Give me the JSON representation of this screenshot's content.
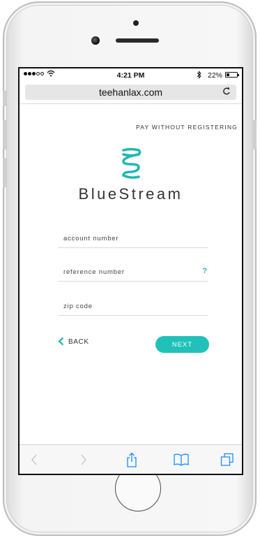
{
  "status_bar": {
    "time": "4:21 PM",
    "battery_percent": "22%",
    "battery_level": 0.22
  },
  "browser": {
    "url": "teehanlax.com"
  },
  "page": {
    "top_link": "PAY WITHOUT REGISTERING",
    "brand_name": "BlueStream",
    "fields": {
      "account_placeholder": "account number",
      "reference_placeholder": "reference number",
      "reference_help": "?",
      "zip_placeholder": "zip code"
    },
    "back_label": "BACK",
    "next_label": "NEXT"
  },
  "colors": {
    "accent": "#21c1ba"
  },
  "icons": [
    "signal-icon",
    "wifi-icon",
    "bluetooth-icon",
    "battery-icon",
    "reload-icon",
    "bluestream-logo-icon",
    "back-chevron-icon",
    "browser-back-icon",
    "browser-forward-icon",
    "share-icon",
    "bookmarks-icon",
    "tabs-icon"
  ]
}
